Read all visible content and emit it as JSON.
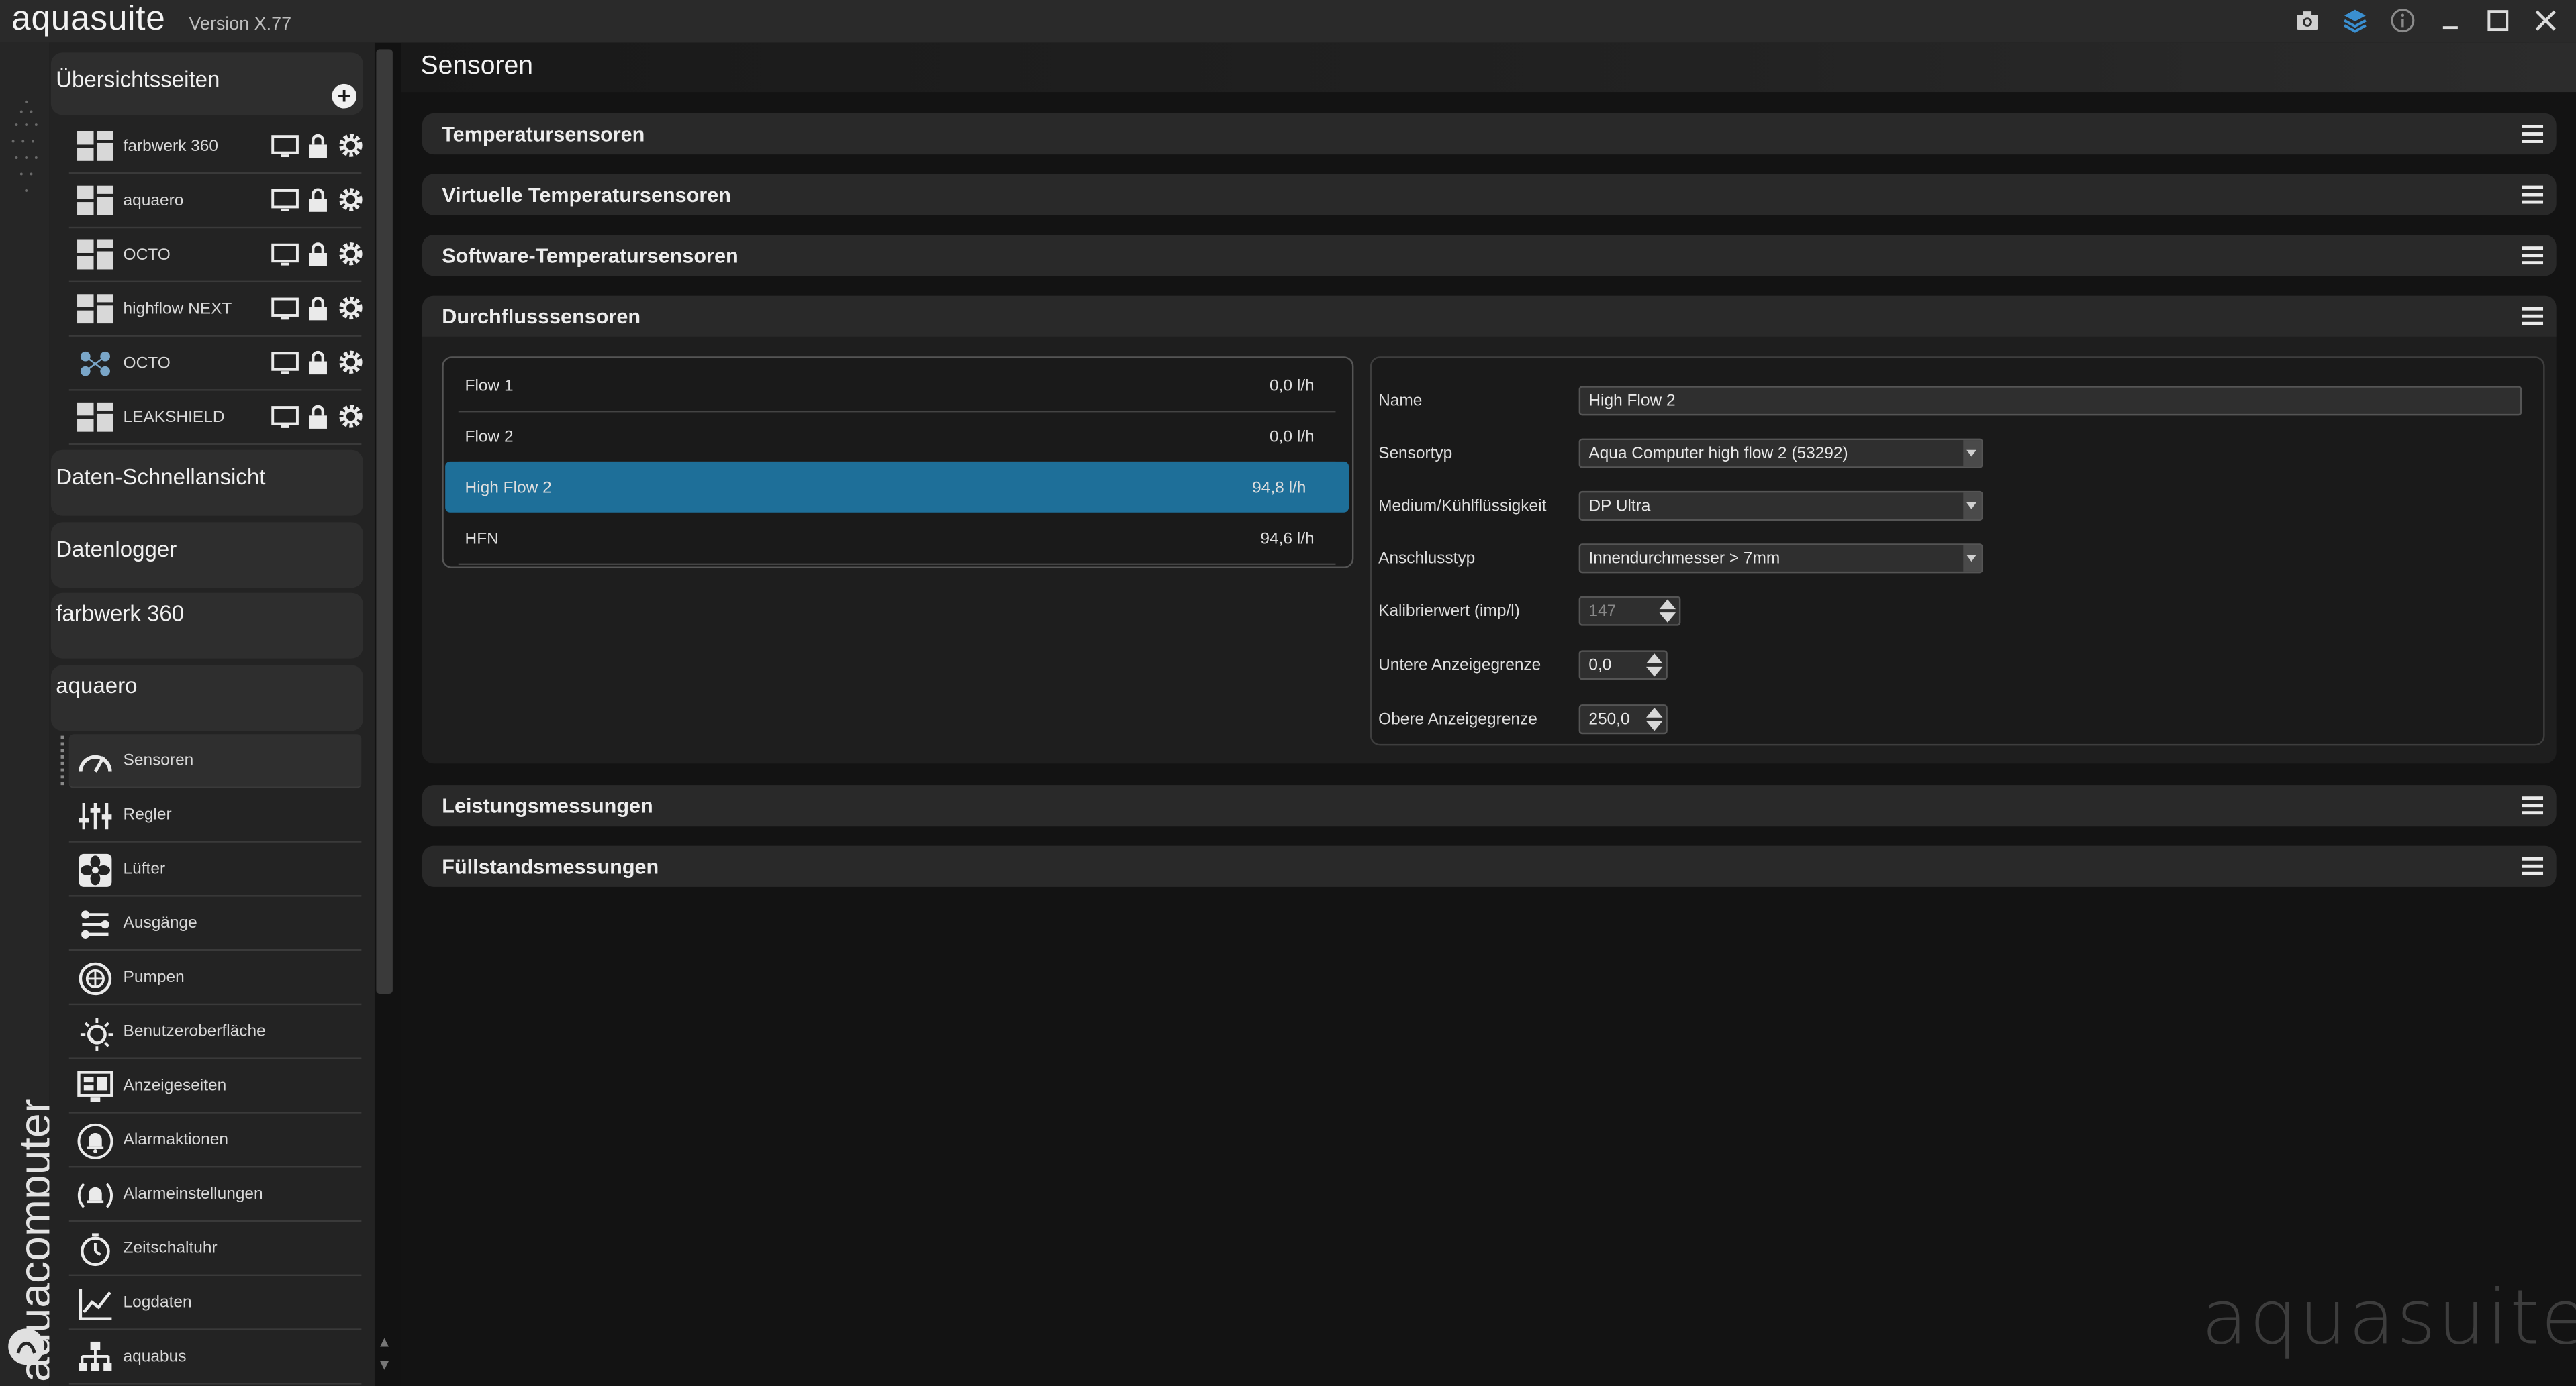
{
  "app": {
    "title": "aquasuite",
    "version": "Version X.77",
    "brand_vertical": "aquacomputer",
    "watermark": "aquasuite",
    "window_icons": [
      "camera-icon",
      "layers-icon",
      "info-icon",
      "minimize-icon",
      "maximize-icon",
      "close-icon"
    ]
  },
  "sidebar": {
    "overview_header": "Übersichtsseiten",
    "overview_pages": [
      {
        "label": "farbwerk 360",
        "icon": "grid-layout-icon"
      },
      {
        "label": "aquaero",
        "icon": "grid-layout-icon"
      },
      {
        "label": "OCTO",
        "icon": "grid-layout-icon"
      },
      {
        "label": "highflow NEXT",
        "icon": "grid-layout-icon"
      },
      {
        "label": "OCTO",
        "icon": "nodes-icon"
      },
      {
        "label": "LEAKSHIELD",
        "icon": "grid-layout-icon"
      }
    ],
    "sections": [
      "Daten-Schnellansicht",
      "Datenlogger",
      "farbwerk 360",
      "aquaero"
    ],
    "nav_items": [
      {
        "label": "Sensoren",
        "icon": "gauge-icon",
        "selected": true
      },
      {
        "label": "Regler",
        "icon": "sliders-icon"
      },
      {
        "label": "Lüfter",
        "icon": "fan-icon"
      },
      {
        "label": "Ausgänge",
        "icon": "outputs-icon"
      },
      {
        "label": "Pumpen",
        "icon": "pump-icon"
      },
      {
        "label": "Benutzeroberfläche",
        "icon": "brightness-icon"
      },
      {
        "label": "Anzeigeseiten",
        "icon": "display-pages-icon"
      },
      {
        "label": "Alarmaktionen",
        "icon": "alarm-bell-icon"
      },
      {
        "label": "Alarmeinstellungen",
        "icon": "alarm-settings-icon"
      },
      {
        "label": "Zeitschaltuhr",
        "icon": "timer-icon"
      },
      {
        "label": "Logdaten",
        "icon": "line-chart-icon"
      },
      {
        "label": "aquabus",
        "icon": "network-tree-icon"
      }
    ]
  },
  "main": {
    "title": "Sensoren",
    "accordions": {
      "temp": "Temperatursensoren",
      "virtual": "Virtuelle Temperatursensoren",
      "software": "Software-Temperatursensoren",
      "flow": "Durchflusssensoren",
      "power": "Leistungsmessungen",
      "level": "Füllstandsmessungen"
    },
    "flow_list": [
      {
        "name": "Flow 1",
        "value": "0,0 l/h"
      },
      {
        "name": "Flow 2",
        "value": "0,0 l/h"
      },
      {
        "name": "High Flow 2",
        "value": "94,8 l/h",
        "selected": true
      },
      {
        "name": "HFN",
        "value": "94,6 l/h"
      }
    ],
    "properties": {
      "name_label": "Name",
      "name_value": "High Flow 2",
      "sensortyp_label": "Sensortyp",
      "sensortyp_value": "Aqua Computer high flow 2 (53292)",
      "medium_label": "Medium/Kühlflüssigkeit",
      "medium_value": "DP Ultra",
      "anschluss_label": "Anschlusstyp",
      "anschluss_value": "Innendurchmesser > 7mm",
      "kalibrier_label": "Kalibrierwert (imp/l)",
      "kalibrier_value": "147",
      "untere_label": "Untere Anzeigegrenze",
      "untere_value": "0,0",
      "obere_label": "Obere Anzeigegrenze",
      "obere_value": "250,0"
    }
  },
  "colors": {
    "accent": "#1e6f99",
    "background": "#121212",
    "panel": "#292929"
  }
}
